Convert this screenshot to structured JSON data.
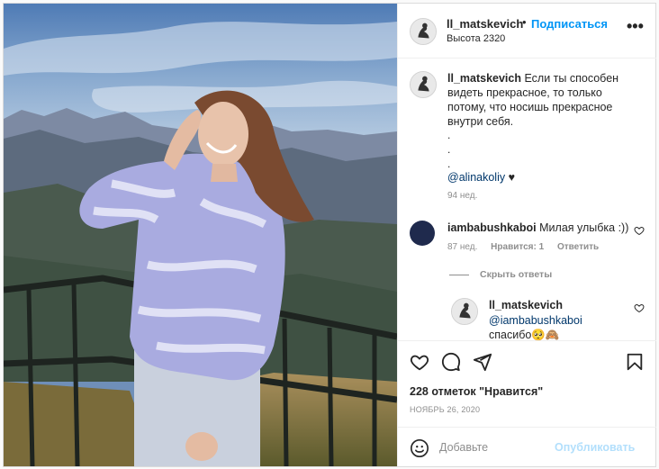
{
  "header": {
    "username": "ll_matskevich",
    "dot": "•",
    "follow_label": "Подписаться",
    "location": "Высота 2320",
    "more": "•••"
  },
  "caption": {
    "username": "ll_matskevich",
    "text": "Если ты способен видеть прекрасное, то только потому, что носишь прекрасное внутри себя.",
    "dots": [
      ".",
      ".",
      "."
    ],
    "mention": "@alinakoliy",
    "heart": "♥",
    "time": "94 нед."
  },
  "comment": {
    "username": "iambabushkaboi",
    "text": "Милая улыбка :))",
    "time": "87 нед.",
    "likes": "Нравится: 1",
    "reply": "Ответить"
  },
  "hide_replies": "Скрыть ответы",
  "reply": {
    "username": "ll_matskevich",
    "mention": "@iambabushkaboi",
    "text": "спасибо🥺🙈"
  },
  "actions": {
    "likes": "228 отметок \"Нравится\"",
    "date": "НОЯБРЬ 26, 2020"
  },
  "add_comment": {
    "placeholder": "Добавьте",
    "publish": "Опубликовать"
  },
  "colors": {
    "accent": "#0095f6",
    "publish_disabled": "#b2dffc",
    "mention": "#00376b",
    "muted": "#8e8e8e"
  },
  "icons": [
    "heart-icon",
    "comment-icon",
    "share-icon",
    "bookmark-icon",
    "emoji-icon",
    "more-icon"
  ]
}
